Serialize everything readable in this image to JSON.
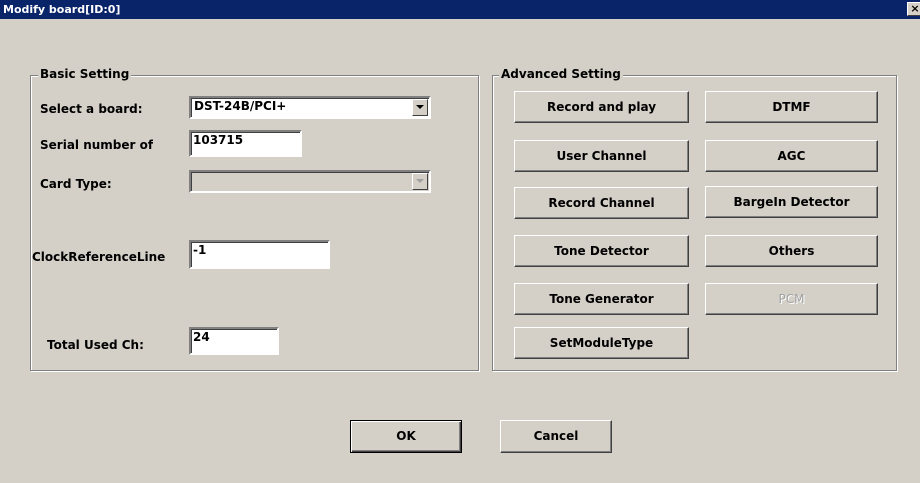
{
  "window": {
    "title": "Modify board[ID:0]",
    "close_glyph": "×"
  },
  "basic_setting": {
    "title": "Basic Setting",
    "select_board_label": "Select a board:",
    "select_board_value": "DST-24B/PCI+",
    "serial_label": "Serial number of",
    "serial_value": "103715",
    "card_type_label": "Card Type:",
    "card_type_value": "",
    "clock_ref_label": "ClockReferenceLine",
    "clock_ref_value": "-1",
    "total_used_label": "Total Used Ch:",
    "total_used_value": "24"
  },
  "advanced_setting": {
    "title": "Advanced Setting",
    "buttons": {
      "record_and_play": "Record and play",
      "dtmf": "DTMF",
      "user_channel": "User Channel",
      "agc": "AGC",
      "record_channel": "Record Channel",
      "bargein_detector": "BargeIn Detector",
      "tone_detector": "Tone Detector",
      "others": "Others",
      "tone_generator": "Tone Generator",
      "pcm": "PCM",
      "set_module_type": "SetModuleType"
    }
  },
  "footer": {
    "ok_label": "OK",
    "cancel_label": "Cancel"
  },
  "colors": {
    "title_bar": "#0a246a",
    "dialog_face": "#d4d0c8",
    "disabled_text": "#a0a0a0"
  }
}
